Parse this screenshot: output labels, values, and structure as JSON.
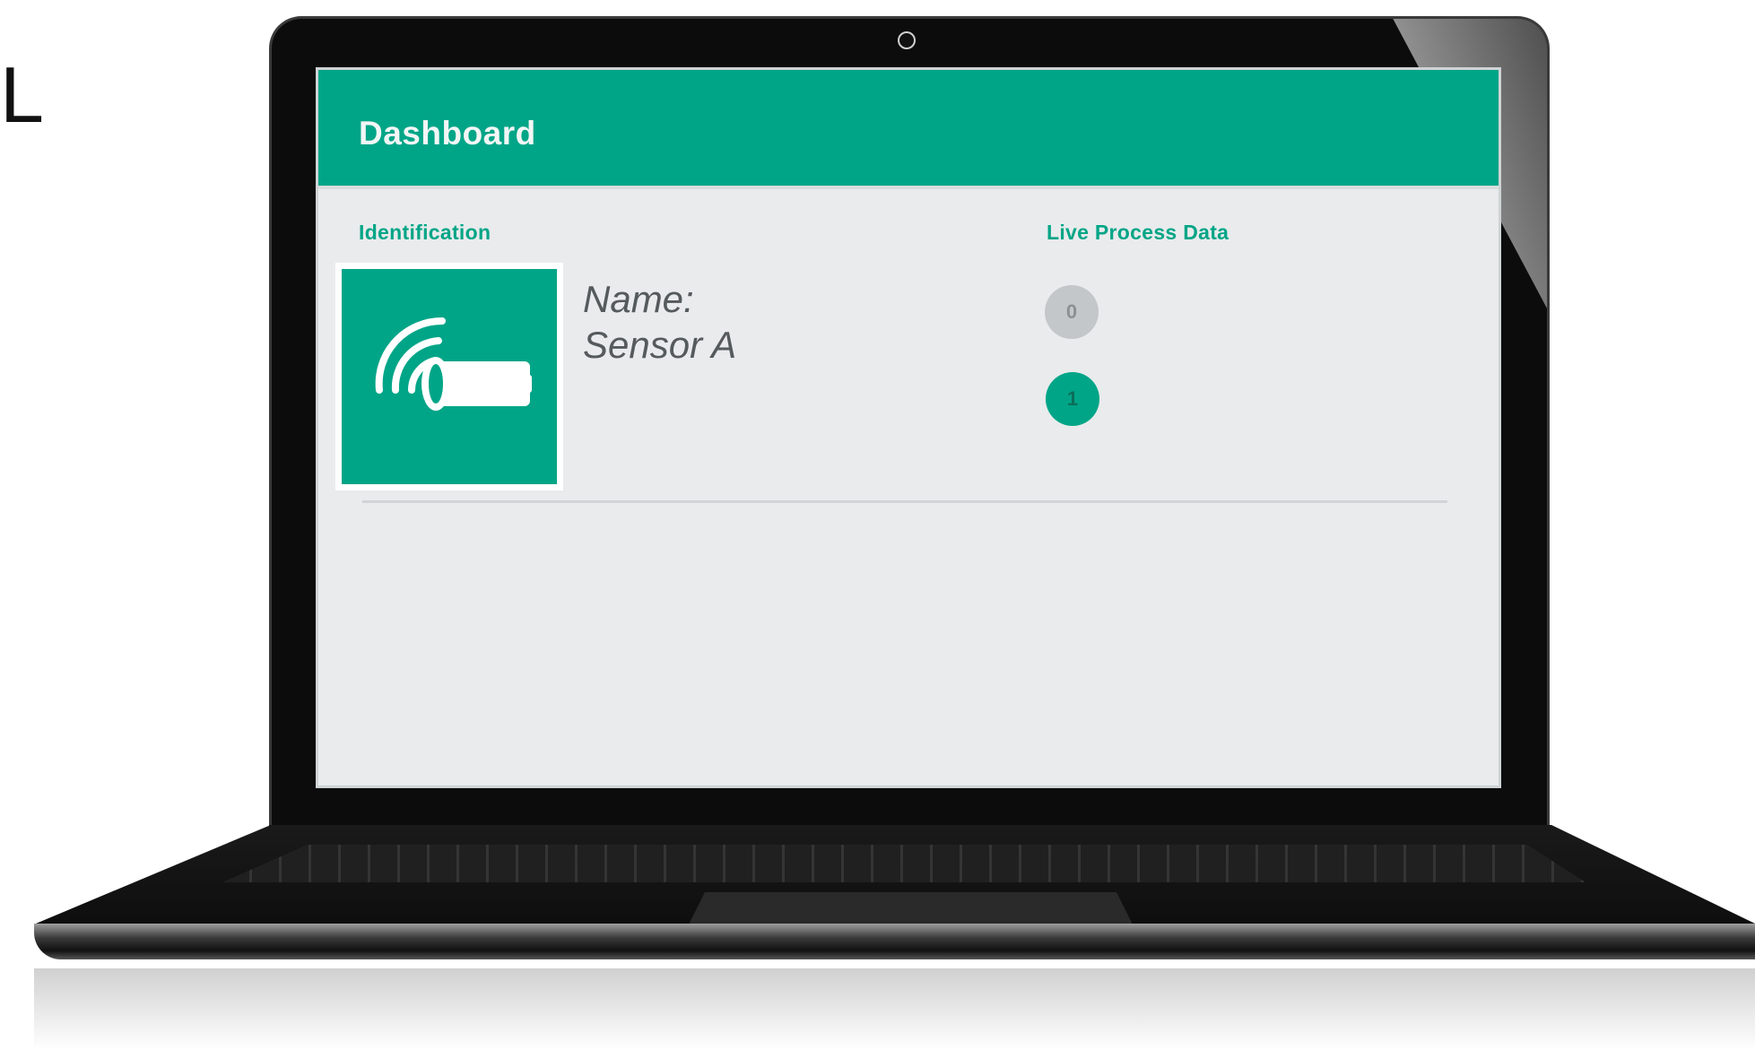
{
  "corner_text": "L",
  "app": {
    "title": "Dashboard",
    "accent_color": "#00a587"
  },
  "identification": {
    "label": "Identification",
    "device_icon": "wireless-sensor-icon",
    "name_label": "Name:",
    "name_value": "Sensor A"
  },
  "process_data": {
    "label": "Live Process Data",
    "indicators": [
      {
        "value": "0",
        "state": "off",
        "color": "#c4c7c9"
      },
      {
        "value": "1",
        "state": "on",
        "color": "#00a587"
      }
    ]
  }
}
